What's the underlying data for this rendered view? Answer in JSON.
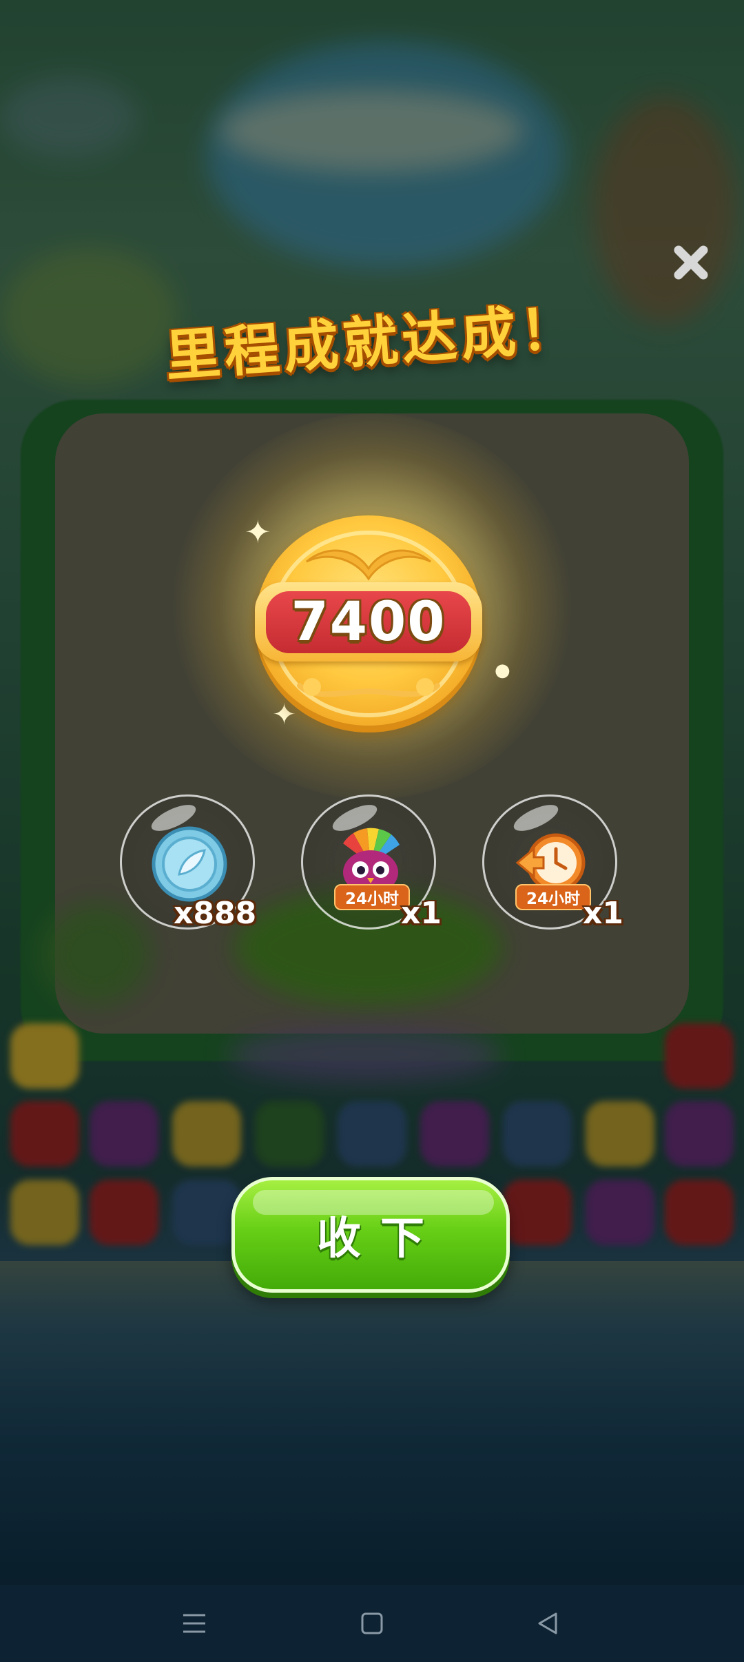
{
  "dialog": {
    "title": "里程成就达成！",
    "milestone_value": "7400"
  },
  "rewards": [
    {
      "item": "coin",
      "quantity": "x888"
    },
    {
      "item": "rainbow-owl-booster",
      "duration": "24小时",
      "quantity": "x1"
    },
    {
      "item": "time-booster",
      "duration": "24小时",
      "quantity": "x1"
    }
  ],
  "buttons": {
    "collect_label": "收下"
  },
  "navbar": {
    "menu_icon": "menu-icon",
    "home_icon": "home-icon",
    "back_icon": "back-icon"
  },
  "colors": {
    "title": "#ffd23b",
    "button_green": "#67cf16",
    "medal_gold": "#ffc940",
    "plaque_red": "#c52c32"
  }
}
